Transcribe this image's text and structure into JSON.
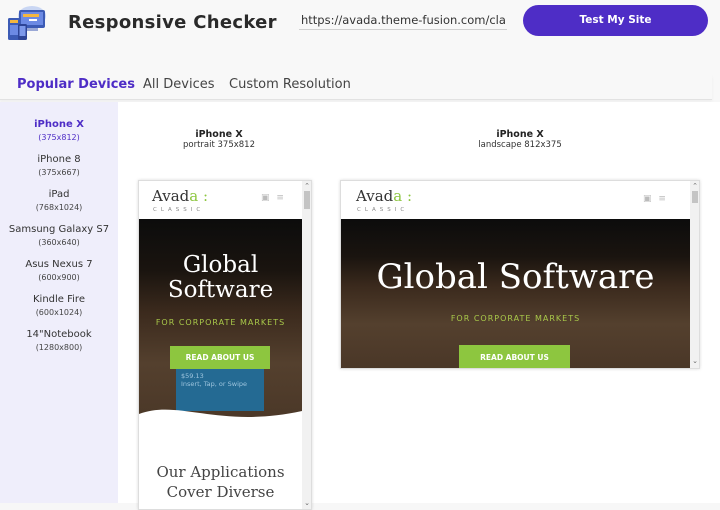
{
  "header": {
    "app_title": "Responsive Checker",
    "url_value": "https://avada.theme-fusion.com/classic/",
    "test_button_label": "Test My Site",
    "logo_icon": "responsive-devices-logo-icon"
  },
  "tabs": [
    {
      "label": "Popular Devices",
      "active": true
    },
    {
      "label": "All Devices",
      "active": false
    },
    {
      "label": "Custom Resolution",
      "active": false
    }
  ],
  "sidebar": {
    "devices": [
      {
        "name": "iPhone X",
        "resolution": "(375x812)",
        "active": true
      },
      {
        "name": "iPhone 8",
        "resolution": "(375x667)"
      },
      {
        "name": "iPad",
        "resolution": "(768x1024)"
      },
      {
        "name": "Samsung Galaxy S7",
        "resolution": "(360x640)"
      },
      {
        "name": "Asus Nexus 7",
        "resolution": "(600x900)"
      },
      {
        "name": "Kindle Fire",
        "resolution": "(600x1024)"
      },
      {
        "name": "14\"Notebook",
        "resolution": "(1280x800)"
      }
    ]
  },
  "previews": {
    "portrait": {
      "device": "iPhone X",
      "orientation": "portrait 375x812"
    },
    "landscape": {
      "device": "iPhone X",
      "orientation": "landscape 812x375"
    }
  },
  "site": {
    "logo_text": "Avad",
    "logo_accent": "a",
    "logo_colon": ":",
    "logo_sub": "CLASSIC",
    "cart_icon": "🛒",
    "menu_icon": "≡",
    "hero_title_portrait_line1": "Global",
    "hero_title_portrait_line2": "Software",
    "hero_title_landscape": "Global Software",
    "hero_subtitle": "FOR CORPORATE MARKETS",
    "hero_button": "READ ABOUT US",
    "card_price": "$59.13",
    "card_text": "Insert, Tap, or Swipe",
    "apps_title_line1": "Our Applications",
    "apps_title_line2": "Cover Diverse"
  },
  "colors": {
    "accent": "#4e2dc6",
    "sidebar_bg": "#efeefb",
    "site_green": "#8dc63f"
  }
}
